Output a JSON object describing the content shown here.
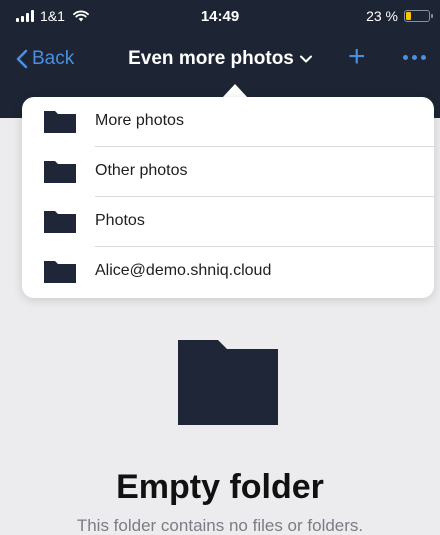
{
  "status_bar": {
    "carrier": "1&1",
    "time": "14:49",
    "battery_text": "23 %",
    "battery_level": 0.23,
    "signal_icon": "signal-bars-icon",
    "wifi_icon": "wifi-icon",
    "battery_icon": "battery-icon"
  },
  "nav": {
    "back_label": "Back",
    "title": "Even more photos",
    "title_chevron_icon": "chevron-down-icon",
    "add_icon": "plus-icon",
    "more_icon": "more-dots-icon"
  },
  "menu": {
    "items": [
      {
        "label": "More photos",
        "icon": "folder-icon"
      },
      {
        "label": "Other photos",
        "icon": "folder-icon"
      },
      {
        "label": "Photos",
        "icon": "folder-icon"
      },
      {
        "label": "Alice@demo.shniq.cloud",
        "icon": "folder-icon"
      }
    ]
  },
  "empty_state": {
    "icon": "folder-icon",
    "title": "Empty folder",
    "subtitle": "This folder contains no files or folders."
  },
  "colors": {
    "header_background": "#1d2434",
    "accent": "#4a8fe0",
    "page_background": "#ececee",
    "folder": "#1f2637",
    "battery_low": "#f7c600"
  }
}
